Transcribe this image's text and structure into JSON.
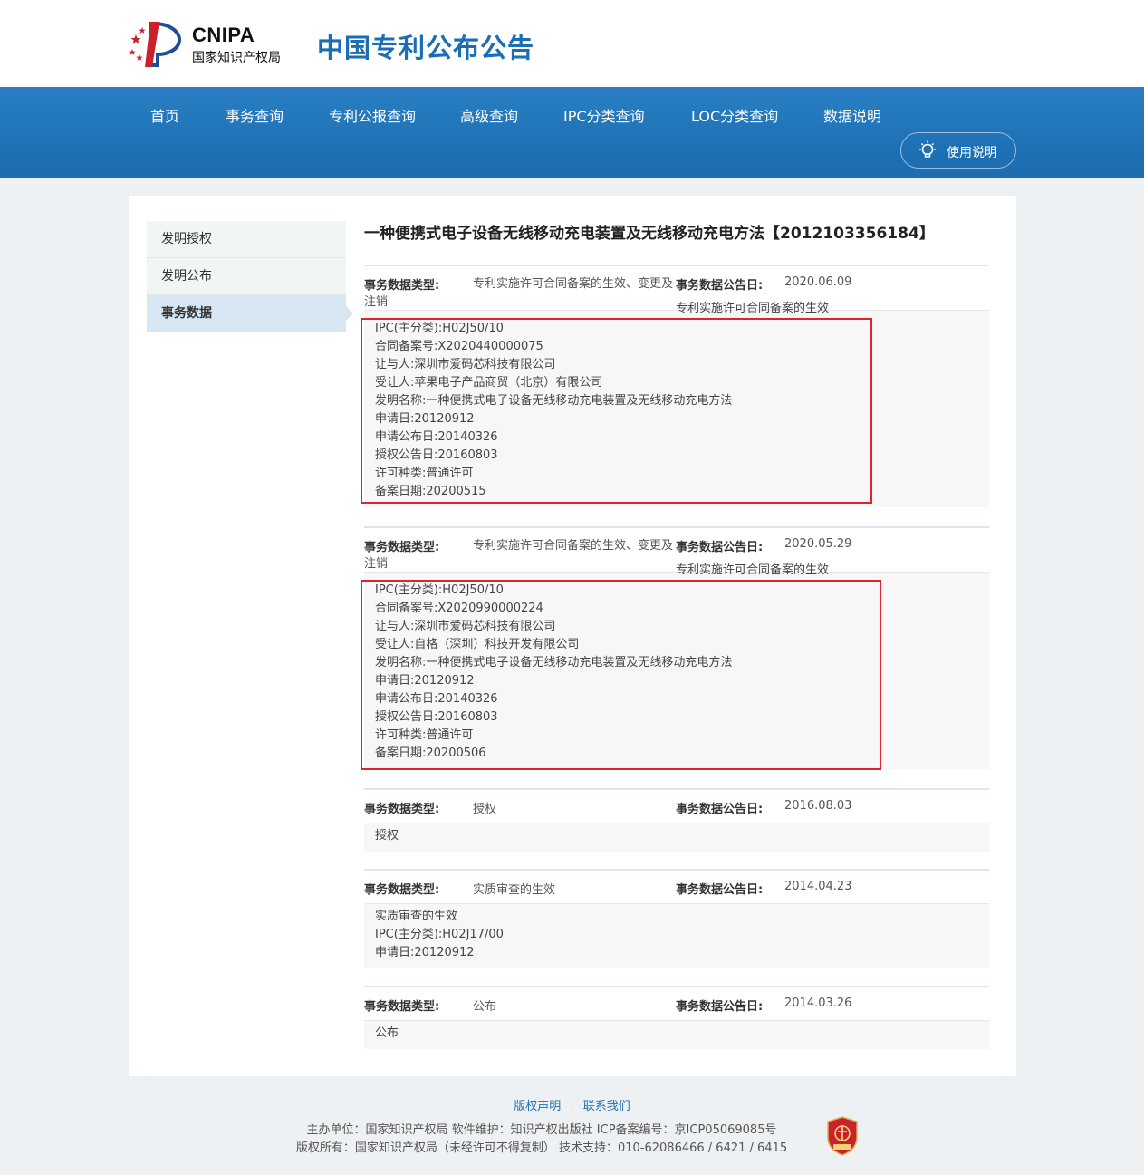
{
  "header": {
    "logo_text": "CNIPA",
    "logo_subtitle": "国家知识产权局",
    "site_title": "中国专利公布公告"
  },
  "nav": {
    "items": [
      "首页",
      "事务查询",
      "专利公报查询",
      "高级查询",
      "IPC分类查询",
      "LOC分类查询",
      "数据说明"
    ],
    "help_label": "使用说明"
  },
  "sidebar": {
    "items": [
      "发明授权",
      "发明公布",
      "事务数据"
    ],
    "active": "事务数据"
  },
  "page_title": "一种便携式电子设备无线移动充电装置及无线移动充电方法【2012103356184】",
  "labels": {
    "type_key": "事务数据类型:",
    "date_key": "事务数据公告日:"
  },
  "records": [
    {
      "type": "专利实施许可合同备案的生效、变更及注销",
      "date": "2020.06.09",
      "subtype": "专利实施许可合同备案的生效",
      "lines": [
        "IPC(主分类):H02J50/10",
        "合同备案号:X2020440000075",
        "让与人:深圳市爱码芯科技有限公司",
        "受让人:苹果电子产品商贸（北京）有限公司",
        "发明名称:一种便携式电子设备无线移动充电装置及无线移动充电方法",
        "申请日:20120912",
        "申请公布日:20140326",
        "授权公告日:20160803",
        "许可种类:普通许可",
        "备案日期:20200515"
      ]
    },
    {
      "type": "专利实施许可合同备案的生效、变更及注销",
      "date": "2020.05.29",
      "subtype": "专利实施许可合同备案的生效",
      "lines": [
        "IPC(主分类):H02J50/10",
        "合同备案号:X2020990000224",
        "让与人:深圳市爱码芯科技有限公司",
        "受让人:自格（深圳）科技开发有限公司",
        "发明名称:一种便携式电子设备无线移动充电装置及无线移动充电方法",
        "申请日:20120912",
        "申请公布日:20140326",
        "授权公告日:20160803",
        "许可种类:普通许可",
        "备案日期:20200506"
      ]
    },
    {
      "type": "授权",
      "date": "2016.08.03",
      "lines": [
        "授权"
      ]
    },
    {
      "type": "实质审查的生效",
      "date": "2014.04.23",
      "lines": [
        "实质审查的生效",
        "IPC(主分类):H02J17/00",
        "申请日:20120912"
      ]
    },
    {
      "type": "公布",
      "date": "2014.03.26",
      "lines": [
        "公布"
      ]
    }
  ],
  "footer": {
    "links": [
      "版权声明",
      "联系我们"
    ],
    "line1": "主办单位：国家知识产权局    软件维护：知识产权出版社    ICP备案编号：京ICP05069085号",
    "line2": "版权所有：国家知识产权局（未经许可不得复制）    技术支持：010-62086466 / 6421 / 6415",
    "badge_text": "党政机关"
  },
  "colors": {
    "nav_blue": "#1f72b6",
    "title_blue": "#1c6eb4",
    "highlight_red": "#d9262f",
    "sidebar_active": "#d6e6f2"
  }
}
